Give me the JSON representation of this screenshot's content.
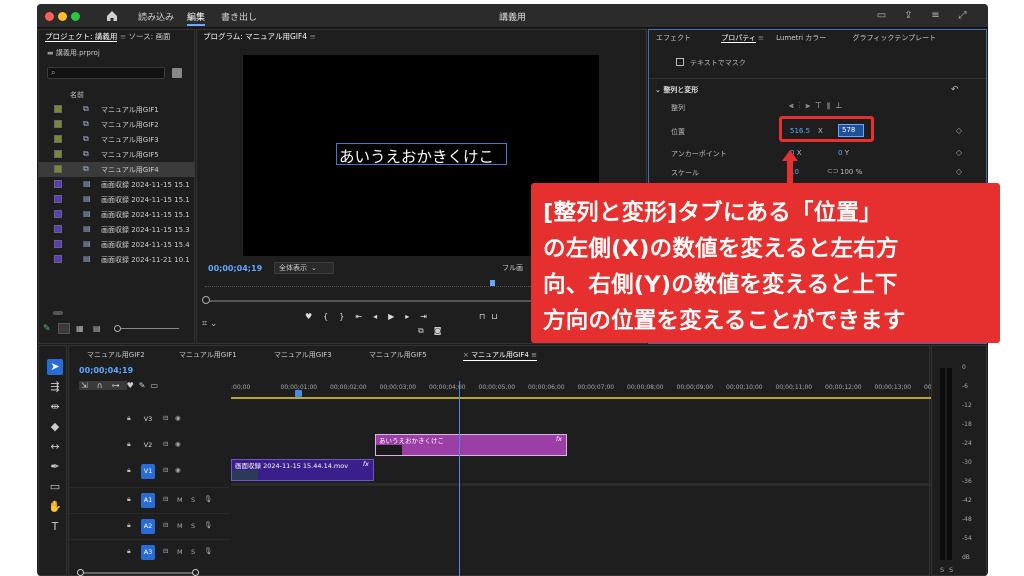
{
  "app": {
    "window_title": "講義用",
    "menus": [
      "読み込み",
      "編集",
      "書き出し"
    ],
    "active_menu": "編集"
  },
  "project": {
    "tab_project": "プロジェクト: 講義用",
    "tab_source": "ソース: 画面",
    "file": "講義用.prproj",
    "column_name": "名前",
    "items": [
      {
        "label": "マニュアル用GIF1",
        "color": "#7a8a2a",
        "type": "sequence"
      },
      {
        "label": "マニュアル用GIF2",
        "color": "#7a8a2a",
        "type": "sequence"
      },
      {
        "label": "マニュアル用GIF3",
        "color": "#7a8a2a",
        "type": "sequence"
      },
      {
        "label": "マニュアル用GIF5",
        "color": "#7a8a2a",
        "type": "sequence"
      },
      {
        "label": "マニュアル用GIF4",
        "color": "#7a8a2a",
        "type": "sequence"
      },
      {
        "label": "画面収録 2024-11-15 15.1",
        "color": "#5a3bbd",
        "type": "clip"
      },
      {
        "label": "画面収録 2024-11-15 15.1",
        "color": "#5a3bbd",
        "type": "clip"
      },
      {
        "label": "画面収録 2024-11-15 15.1",
        "color": "#5a3bbd",
        "type": "clip"
      },
      {
        "label": "画面収録 2024-11-15 15.3",
        "color": "#5a3bbd",
        "type": "clip"
      },
      {
        "label": "画面収録 2024-11-15 15.4",
        "color": "#5a3bbd",
        "type": "clip"
      },
      {
        "label": "画面収録 2024-11-21 10.1",
        "color": "#5a3bbd",
        "type": "clip"
      }
    ]
  },
  "program": {
    "tab": "プログラム: マニュアル用GIF4",
    "overlay_text": "あいうえおかきくけこ",
    "timecode": "00;00;04;19",
    "zoom": "全体表示",
    "quality": "フル画"
  },
  "effects": {
    "tabs": [
      "エフェクト",
      "プロパティ",
      "Lumetri カラー",
      "グラフィックテンプレート"
    ],
    "active_tab": "プロパティ",
    "mask_label": "テキストでマスク",
    "section": "整列と変形",
    "align_label": "整列",
    "position_label": "位置",
    "position_x": "516.5",
    "position_y": "578",
    "x_unit": "X",
    "anchor_label": "アンカーポイント",
    "anchor_x": "0",
    "anchor_y": "0",
    "y_unit": "Y",
    "scale_label": "スケール",
    "scale_value": "10",
    "scale_percent": "100 %"
  },
  "timeline": {
    "tabs": [
      "マニュアル用GIF2",
      "マニュアル用GIF1",
      "マニュアル用GIF3",
      "マニュアル用GIF5",
      "マニュアル用GIF4"
    ],
    "active_tab": "マニュアル用GIF4",
    "timecode": "00;00;04;19",
    "ruler": [
      ":00;00",
      "00;00;01;00",
      "00;00;02;00",
      "00;00;03;00",
      "00;00;04;00",
      "00;00;05;00",
      "00;00;06;00",
      "00;00;07;00",
      "00;00;08;00",
      "00;00;09;00",
      "00;00;10;00",
      "00;00;11;00",
      "00;00;12;00",
      "00;00;13;00",
      "00;00;14;00"
    ],
    "tracks": [
      "V3",
      "V2",
      "V1",
      "A1",
      "A2",
      "A3"
    ],
    "clip_text": "あいうえおかきくけこ",
    "clip_video": "画面収録 2024-11-15 15.44.14.mov",
    "fx": "fx",
    "m": "M",
    "s": "S"
  },
  "meter": {
    "scale": [
      "0",
      "-6",
      "-12",
      "-18",
      "-24",
      "-30",
      "-36",
      "-42",
      "-48",
      "-54",
      "dB"
    ],
    "s1": "S",
    "s2": "S"
  },
  "callout": {
    "lines": [
      "[整列と変形]タブにある「位置」",
      "の左側(X)の数値を変えると左右方",
      "向、右側(Y)の数値を変えると上下",
      "方向の位置を変えることができます"
    ],
    "color": "#e5302f"
  },
  "colors": {
    "accent": "#2a6cd6",
    "highlight_box": "#e5302f",
    "text_clip": "#9b3fa7",
    "video_clip": "#3a1f8c"
  }
}
